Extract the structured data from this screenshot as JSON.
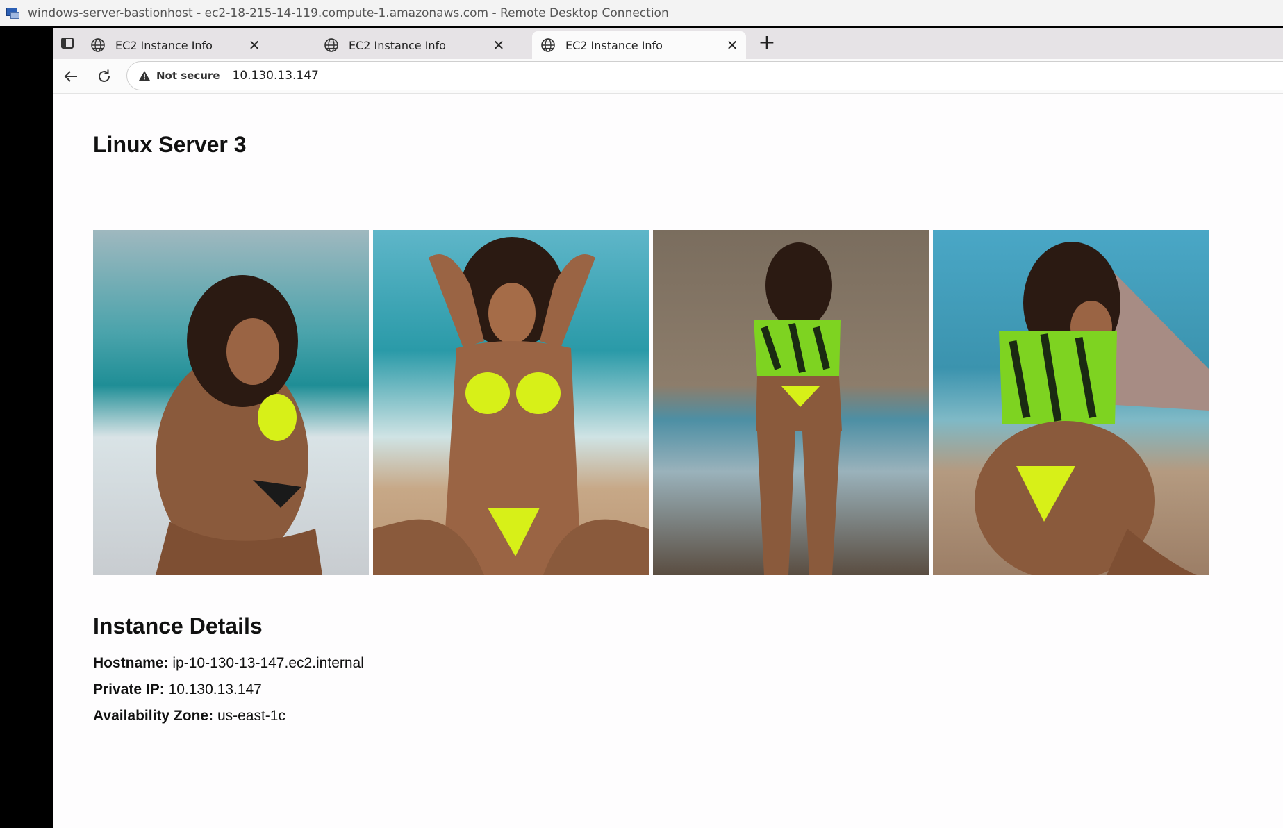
{
  "window": {
    "title": "windows-server-bastionhost - ec2-18-215-14-119.compute-1.amazonaws.com - Remote Desktop Connection"
  },
  "browser": {
    "tabs": [
      {
        "label": "EC2 Instance Info",
        "active": false
      },
      {
        "label": "EC2 Instance Info",
        "active": false
      },
      {
        "label": "EC2 Instance Info",
        "active": true
      }
    ],
    "close_glyph": "✕",
    "newtab_glyph": "+",
    "address": {
      "security_label": "Not secure",
      "url": "10.130.13.147"
    }
  },
  "page": {
    "title": "Linux Server 3",
    "gallery": [
      {
        "icon": "photo-1"
      },
      {
        "icon": "photo-2"
      },
      {
        "icon": "photo-3"
      },
      {
        "icon": "photo-4"
      }
    ],
    "details": {
      "heading": "Instance Details",
      "hostname_label": "Hostname:",
      "hostname_value": "ip-10-130-13-147.ec2.internal",
      "private_ip_label": "Private IP:",
      "private_ip_value": "10.130.13.147",
      "az_label": "Availability Zone:",
      "az_value": "us-east-1c"
    }
  },
  "colors": {
    "accent": "#d7f018",
    "tabstrip": "#e6e3e6"
  }
}
